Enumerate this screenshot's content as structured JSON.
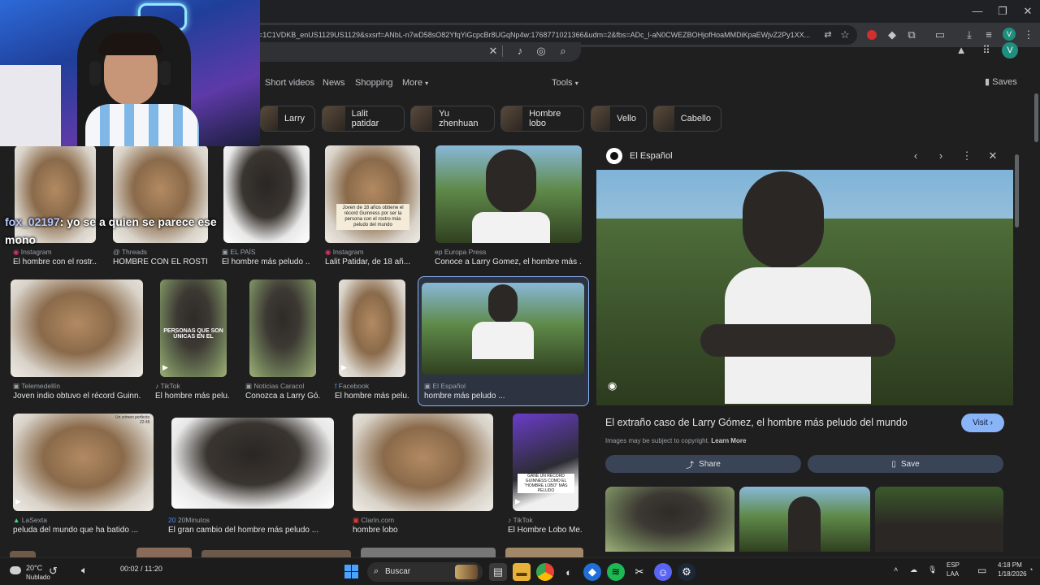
{
  "browser": {
    "url": "=1C1VDKB_enUS1129US1129&sxsrf=ANbL-n7wD58sO82YfqYiGcpcBr8UGqNp4w:1768771021366&udm=2&fbs=ADc_l-aN0CWEZBOHjofHoaMMDiKpaEWjvZ2Py1XX...",
    "profile_initial": "V"
  },
  "google": {
    "nav_tabs": [
      "Short videos",
      "News",
      "Shopping",
      "More"
    ],
    "tools_label": "Tools",
    "saves_label": "Saves",
    "account_initial": "V",
    "chips": [
      "Larry",
      "Lalit patidar",
      "Yu zhenhuan",
      "Hombre lobo",
      "Vello",
      "Cabello"
    ]
  },
  "results": [
    {
      "source": "Instagram",
      "title": "El hombre con el rostr..."
    },
    {
      "source": "Threads",
      "title": "HOMBRE CON EL ROSTR..."
    },
    {
      "source": "EL PAÍS",
      "title": "El hombre más peludo ..."
    },
    {
      "source": "Instagram",
      "title": "Lalit Patidar, de 18 añ..."
    },
    {
      "source": "Europa Press",
      "title": "Conoce a Larry Gomez, el hombre más ..."
    },
    {
      "source": "Telemedellín",
      "title": "Joven indio obtuvo el récord Guinn..."
    },
    {
      "source": "TikTok",
      "title": "El hombre más pelu..."
    },
    {
      "source": "Noticias Caracol",
      "title": "Conozca a Larry Gó..."
    },
    {
      "source": "Facebook",
      "title": "El hombre más pelu..."
    },
    {
      "source": "El Español",
      "title": "hombre más peludo ..."
    },
    {
      "source": "LaSexta",
      "title": "peluda del mundo que ha batido ..."
    },
    {
      "source": "20Minutos",
      "title": "El gran cambio del hombre más peludo ..."
    },
    {
      "source": "Clarin.com",
      "title": "hombre lobo"
    },
    {
      "source": "TikTok",
      "title": "El Hombre Lobo Me..."
    }
  ],
  "thumb_text": {
    "r1c4": "Joven de 18 años obtiene el récord Guinness por ser la persona con el rostro más peludo del mundo",
    "r2c2": "PERSONAS QUE SON ÚNICAS EN EL",
    "r3c1": "Un crimen perfecto",
    "r3c1_time": "22:45",
    "r3c4": "GANÉ UN RÉCORD GUINNESS COMO EL \"HOMBRE LOBO\" MÁS PELUDO"
  },
  "panel": {
    "source": "El Español",
    "title": "El extraño caso de Larry Gómez, el hombre más peludo del mundo",
    "copyright": "Images may be subject to copyright.",
    "learn_more": "Learn More",
    "visit_label": "Visit",
    "share_label": "Share",
    "save_label": "Save"
  },
  "chat_overlay": {
    "user": "fox_02197",
    "message": ": yo se a quien se parece ese mono"
  },
  "taskbar": {
    "weather_temp": "20°C",
    "weather_desc": "Nublado",
    "media_time": "00:02 / 11:20",
    "search_label": "Buscar",
    "lang1": "ESP",
    "lang2": "LAA",
    "clock_time": "4:18 PM",
    "clock_date": "1/18/2026"
  }
}
